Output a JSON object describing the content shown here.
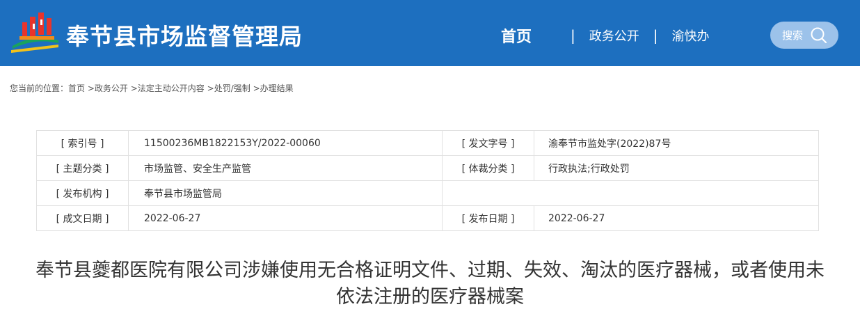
{
  "header": {
    "site_title": "奉节县市场监督管理局",
    "logo": "county-emblem-logo",
    "brand_color": "#1d6fbf"
  },
  "nav": {
    "items": [
      "首页",
      "政务公开",
      "渝快办"
    ],
    "separator": "|"
  },
  "search": {
    "label": "搜索",
    "icon": "search-icon"
  },
  "breadcrumb": {
    "prefix": "您当前的位置：",
    "items": [
      "首页",
      ">政务公开",
      ">法定主动公开内容",
      ">处罚/强制",
      ">办理结果"
    ]
  },
  "meta": {
    "rows": [
      {
        "label1": "[ 索引号 ]",
        "value1": "11500236MB1822153Y/2022-00060",
        "label2": "[ 发文字号 ]",
        "value2": "渝奉节市监处字(2022)87号"
      },
      {
        "label1": "[ 主题分类 ]",
        "value1": "市场监管、安全生产监管",
        "label2": "[ 体裁分类 ]",
        "value2": "行政执法;行政处罚"
      },
      {
        "label1": "[ 发布机构 ]",
        "value1": "奉节县市场监管局",
        "label2": "",
        "value2": ""
      },
      {
        "label1": "[ 成文日期 ]",
        "value1": "2022-06-27",
        "label2": "[ 发布日期 ]",
        "value2": "2022-06-27"
      }
    ]
  },
  "document": {
    "title": "奉节县夔都医院有限公司涉嫌使用无合格证明文件、过期、失效、淘汰的医疗器械，或者使用未依法注册的医疗器械案"
  }
}
